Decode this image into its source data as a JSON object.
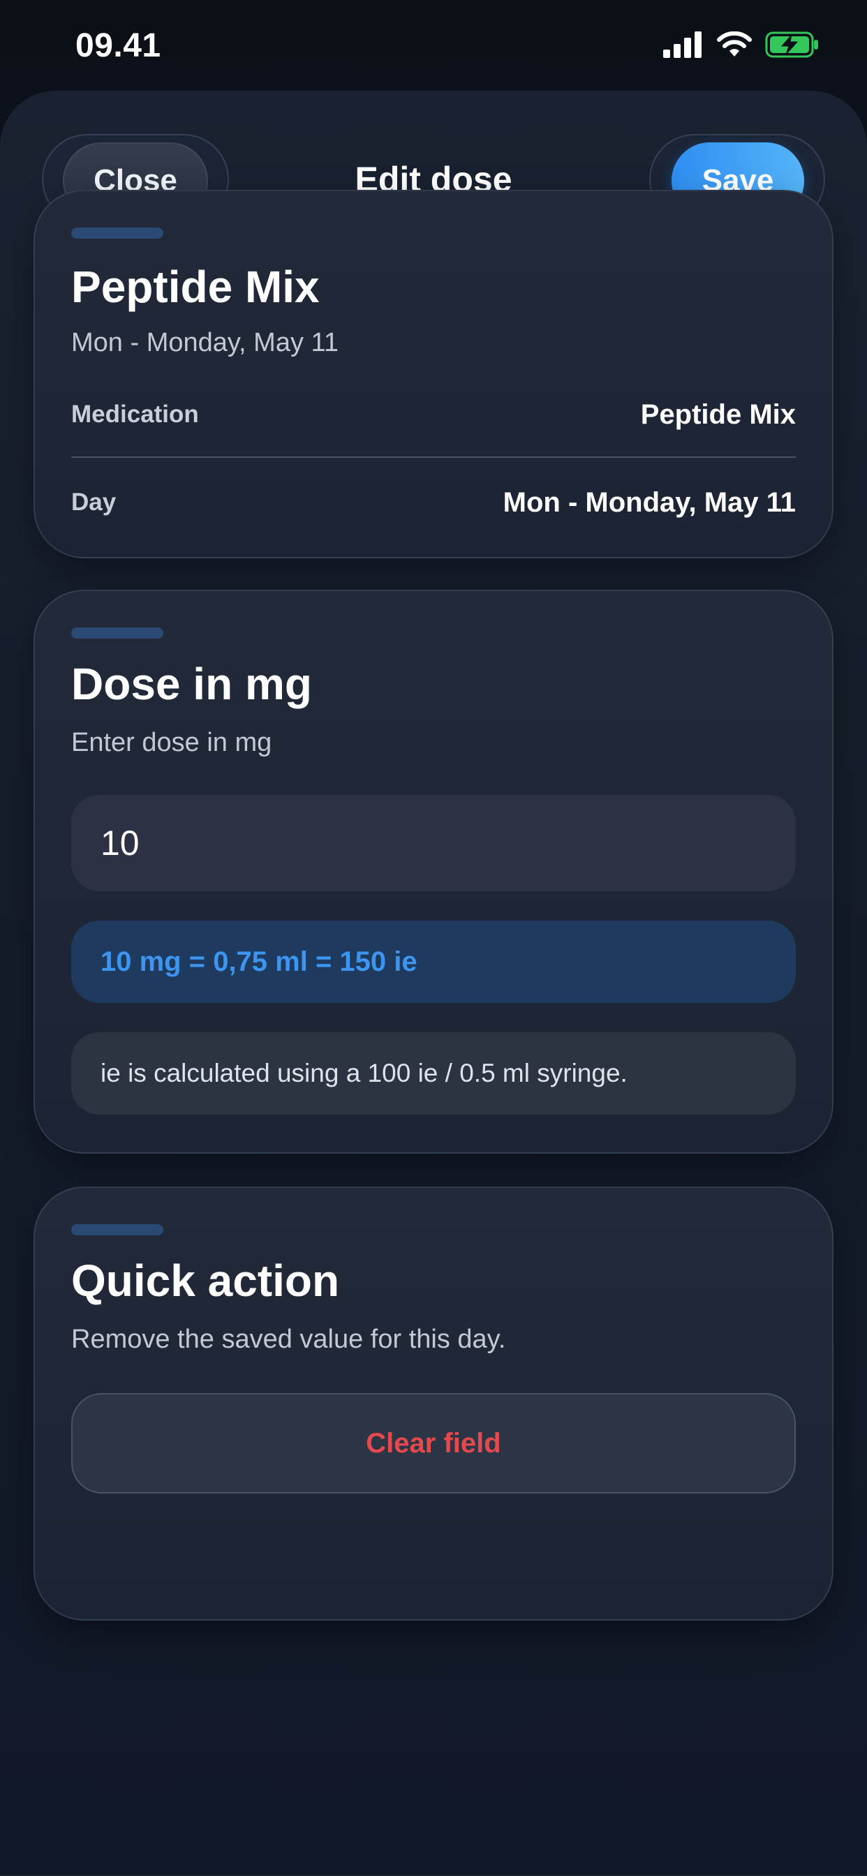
{
  "status_bar": {
    "time": "09.41",
    "icons": [
      "signal-icon",
      "wifi-icon",
      "battery-charging-icon"
    ]
  },
  "header": {
    "close_label": "Close",
    "title": "Edit dose",
    "save_label": "Save"
  },
  "summary_card": {
    "title": "Peptide Mix",
    "subtitle": "Mon - Monday, May 11",
    "rows": [
      {
        "label": "Medication",
        "value": "Peptide Mix"
      },
      {
        "label": "Day",
        "value": "Mon - Monday, May 11"
      }
    ]
  },
  "dose_card": {
    "title": "Dose in mg",
    "subtitle": "Enter dose in mg",
    "input_value": "10",
    "conversion": "10 mg = 0,75 ml = 150 ie",
    "note": "ie is calculated using a 100 ie / 0.5 ml syringe."
  },
  "quick_action_card": {
    "title": "Quick action",
    "subtitle": "Remove the saved value for this day.",
    "clear_label": "Clear field"
  },
  "colors": {
    "accent_blue": "#2f8ef2",
    "conversion_text": "#3d95f0",
    "destructive_red": "#e5484d",
    "battery_green": "#34c759"
  }
}
